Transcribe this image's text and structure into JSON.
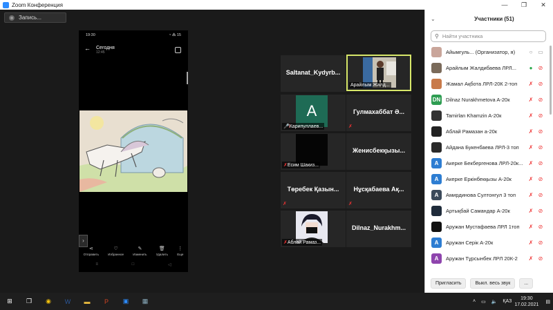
{
  "window": {
    "title": "Zoom Конференция",
    "controls": [
      "—",
      "❐",
      "✕"
    ]
  },
  "record": {
    "label": "Запись..."
  },
  "phone": {
    "status_time": "19:30",
    "status_right": "◔ ⁂ 15",
    "header_title": "Сегодня",
    "header_sub": "12:45",
    "actions": [
      {
        "icon": "share-icon",
        "glyph": "⋖",
        "label": "Отправить"
      },
      {
        "icon": "heart-icon",
        "glyph": "♡",
        "label": "Избранное"
      },
      {
        "icon": "edit-icon",
        "glyph": "✎",
        "label": "Изменить"
      },
      {
        "icon": "trash-icon",
        "glyph": "🗑",
        "label": "Удалить"
      },
      {
        "icon": "more-icon",
        "glyph": "⋮",
        "label": "Еще"
      }
    ],
    "nav": [
      "≡",
      "□",
      "◁"
    ]
  },
  "tiles": [
    {
      "name": "Saltanat_Kydyrb...",
      "caption": "",
      "muted": false,
      "kind": "name"
    },
    {
      "name": "",
      "caption": "Арайлым Жалд...",
      "muted": false,
      "kind": "photo",
      "active": true
    },
    {
      "name": "",
      "caption": "Карипуллаев...",
      "muted": true,
      "kind": "letter",
      "letter": "A"
    },
    {
      "name": "Гулмахаббат Ә...",
      "caption": "",
      "muted": true,
      "kind": "name"
    },
    {
      "name": "",
      "caption": "Есим Шакиз...",
      "muted": true,
      "kind": "dark"
    },
    {
      "name": "Женисбекқызы...",
      "caption": "",
      "muted": false,
      "kind": "name"
    },
    {
      "name": "Төребек Қазын...",
      "caption": "",
      "muted": true,
      "kind": "name"
    },
    {
      "name": "Нұсқабаева Ақ...",
      "caption": "",
      "muted": true,
      "kind": "name"
    },
    {
      "name": "",
      "caption": "Аблай Рамаз...",
      "muted": true,
      "kind": "anime"
    },
    {
      "name": "Dilnaz_Nurakhm...",
      "caption": "",
      "muted": false,
      "kind": "name"
    }
  ],
  "participants_panel": {
    "title": "Участники (51)",
    "search_placeholder": "Найти участника",
    "participants": [
      {
        "name": "Айымгуль... (Организатор, я)",
        "avatar": "photo",
        "color": "#c9a59a",
        "mic": "neutral",
        "cam": "on"
      },
      {
        "name": "Арайлым Жалдибаева ЛРЛ...",
        "avatar": "photo",
        "color": "#7a6a5a",
        "mic": "on",
        "cam": "off"
      },
      {
        "name": "Жамал Ақбота ЛРЛ-20К 2-топ",
        "avatar": "photo",
        "color": "#c87a4a",
        "mic": "off",
        "cam": "off"
      },
      {
        "name": "Dilnaz Nurakhmetova A-20к",
        "avatar": "DN",
        "color": "#2e9d52",
        "mic": "off",
        "cam": "off"
      },
      {
        "name": "Tamirlan Khamzin A-20к",
        "avatar": "photo",
        "color": "#333333",
        "mic": "off",
        "cam": "off"
      },
      {
        "name": "Аблай Рамазан a-20к",
        "avatar": "photo",
        "color": "#222222",
        "mic": "off",
        "cam": "off"
      },
      {
        "name": "Айдана Букенбаева ЛРЛ-3 топ",
        "avatar": "photo",
        "color": "#2a2a2a",
        "mic": "off",
        "cam": "off"
      },
      {
        "name": "Акерке Бекбергенова ЛРЛ-20к...",
        "avatar": "A",
        "color": "#2d7dd2",
        "mic": "off",
        "cam": "off"
      },
      {
        "name": "Акерке Еркінбекқызы А-20к",
        "avatar": "A",
        "color": "#2d7dd2",
        "mic": "off",
        "cam": "off"
      },
      {
        "name": "Амирдинова Султонгул 3 топ",
        "avatar": "A",
        "color": "#3b4a5a",
        "mic": "off",
        "cam": "off"
      },
      {
        "name": "Артықбай Самандар А-20к",
        "avatar": "photo",
        "color": "#1f2b3a",
        "mic": "off",
        "cam": "off"
      },
      {
        "name": "Аружан Мустафаева ЛРЛ 1топ",
        "avatar": "photo",
        "color": "#111111",
        "mic": "off",
        "cam": "off"
      },
      {
        "name": "Аружан Серік А-20к",
        "avatar": "A",
        "color": "#2d7dd2",
        "mic": "off",
        "cam": "off"
      },
      {
        "name": "Аружан Тұрсынбек ЛРЛ 20К-2",
        "avatar": "A",
        "color": "#8e44ad",
        "mic": "off",
        "cam": "off"
      }
    ],
    "footer": {
      "invite": "Пригласить",
      "mute_all": "Выкл. весь звук",
      "more": "..."
    }
  },
  "taskbar": {
    "apps": [
      "windows-icon",
      "taskview-icon",
      "chrome-icon",
      "word-icon",
      "explorer-icon",
      "powerpoint-icon",
      "zoom-icon",
      "photos-icon"
    ],
    "lang": "ҚАЗ",
    "time": "19:30",
    "date": "17.02.2021",
    "notif": "2"
  }
}
